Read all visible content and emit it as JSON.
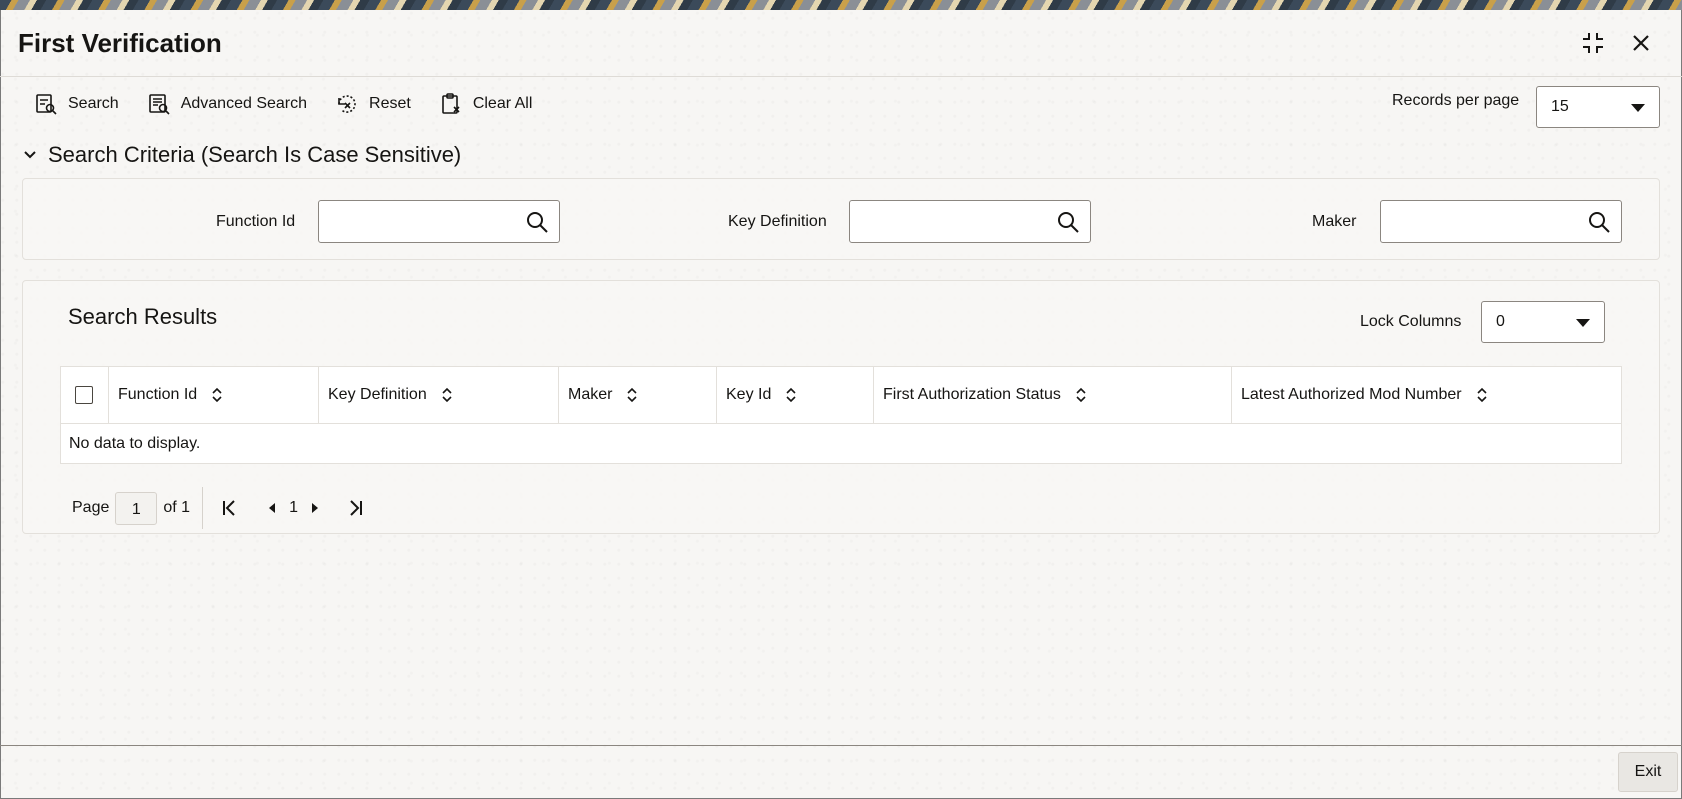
{
  "window": {
    "title": "First Verification"
  },
  "toolbar": {
    "search_label": "Search",
    "advanced_search_label": "Advanced Search",
    "reset_label": "Reset",
    "clear_all_label": "Clear All"
  },
  "records_per_page": {
    "label": "Records per page",
    "value": "15"
  },
  "search_criteria": {
    "title": "Search Criteria (Search Is Case Sensitive)",
    "fields": [
      {
        "label": "Function Id",
        "value": ""
      },
      {
        "label": "Key Definition",
        "value": ""
      },
      {
        "label": "Maker",
        "value": ""
      }
    ]
  },
  "results": {
    "title": "Search Results",
    "lock_columns_label": "Lock Columns",
    "lock_columns_value": "0",
    "columns": [
      "Function Id",
      "Key Definition",
      "Maker",
      "Key Id",
      "First Authorization Status",
      "Latest Authorized Mod Number"
    ],
    "empty_message": "No data to display."
  },
  "pagination": {
    "page_label": "Page",
    "current_page": "1",
    "of_label": "of 1",
    "page_number": "1"
  },
  "footer": {
    "exit_label": "Exit"
  }
}
